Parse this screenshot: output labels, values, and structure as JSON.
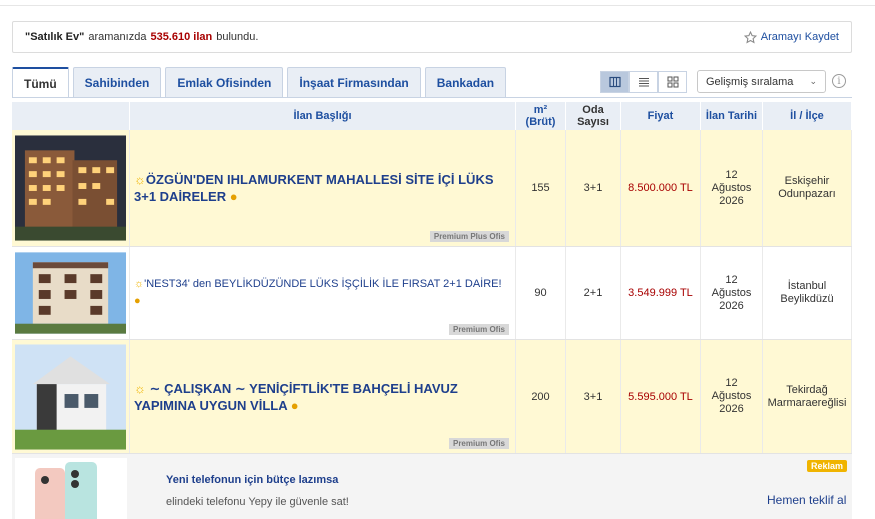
{
  "summary": {
    "query": "\"Satılık Ev\"",
    "prefix": "aramanızda",
    "count": "535.610 ilan",
    "suffix": "bulundu.",
    "save_label": "Aramayı Kaydet"
  },
  "tabs": [
    "Tümü",
    "Sahibinden",
    "Emlak Ofisinden",
    "İnşaat Firmasından",
    "Bankadan"
  ],
  "sort": {
    "value": "Gelişmiş sıralama"
  },
  "columns": {
    "title": "İlan Başlığı",
    "m2_top": "m²",
    "m2_bottom": "(Brüt)",
    "room_top": "Oda",
    "room_bottom": "Sayısı",
    "price": "Fiyat",
    "date": "İlan Tarihi",
    "location": "İl / İlçe"
  },
  "listings": [
    {
      "title": "ÖZGÜN'DEN IHLAMURKENT MAHALLESİ SİTE İÇİ LÜKS 3+1 DAİRELER",
      "m2": "155",
      "rooms": "3+1",
      "price": "8.500.000 TL",
      "date_day": "12",
      "date_month": "Ağustos",
      "date_year": "2026",
      "city": "Eskişehir",
      "district": "Odunpazarı",
      "badge": "Premium Plus Ofis"
    },
    {
      "title": "'NEST34' den BEYLİKDÜZÜNDE LÜKS İŞÇİLİK İLE FIRSAT 2+1 DAİRE!",
      "m2": "90",
      "rooms": "2+1",
      "price": "3.549.999 TL",
      "date_day": "12",
      "date_month": "Ağustos",
      "date_year": "2026",
      "city": "İstanbul",
      "district": "Beylikdüzü",
      "badge": "Premium Ofis"
    },
    {
      "title_part1": "ÇALIŞKAN",
      "title_part2": "YENİÇİFTLİK'TE BAHÇELİ HAVUZ YAPIMINA UYGUN VİLLA",
      "m2": "200",
      "rooms": "3+1",
      "price": "5.595.000 TL",
      "date_day": "12",
      "date_month": "Ağustos",
      "date_year": "2026",
      "city": "Tekirdağ",
      "district": "Marmaraereğlisi",
      "badge": "Premium Ofis"
    }
  ],
  "ad": {
    "title": "Yeni telefonun için bütçe lazımsa",
    "subtitle": "elindeki telefonu Yepy ile güvenle sat!",
    "badge": "Reklam",
    "cta": "Hemen teklif al"
  },
  "colors": {
    "accent": "#1e4fa0",
    "price": "#a80000",
    "highlight": "#fff9d4",
    "ad_badge": "#f0b400"
  }
}
